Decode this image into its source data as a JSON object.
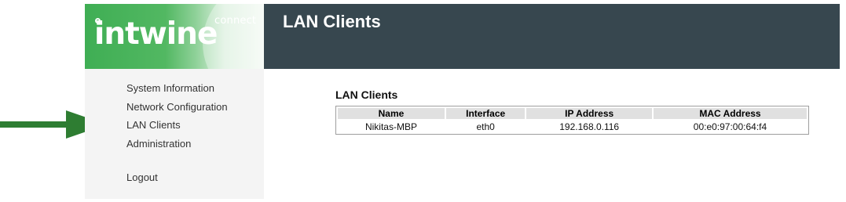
{
  "brand": {
    "connect": "connect",
    "name": "intwine"
  },
  "header": {
    "title": "LAN Clients"
  },
  "sidebar": {
    "items": [
      {
        "label": "System Information"
      },
      {
        "label": "Network Configuration"
      },
      {
        "label": "LAN Clients"
      },
      {
        "label": "Administration"
      },
      {
        "label": "Logout"
      }
    ]
  },
  "main": {
    "section_title": "LAN Clients",
    "table": {
      "columns": [
        "Name",
        "Interface",
        "IP Address",
        "MAC Address"
      ],
      "rows": [
        [
          "Nikitas-MBP",
          "eth0",
          "192.168.0.116",
          "00:e0:97:00:64:f4"
        ]
      ]
    }
  },
  "annotation": {
    "arrow_color": "#2e7d32",
    "arrow_icon": "arrow-right-icon"
  },
  "colors": {
    "header_bg": "#37474f",
    "brand_green": "#3fae54",
    "sidebar_bg": "#f4f4f4"
  }
}
